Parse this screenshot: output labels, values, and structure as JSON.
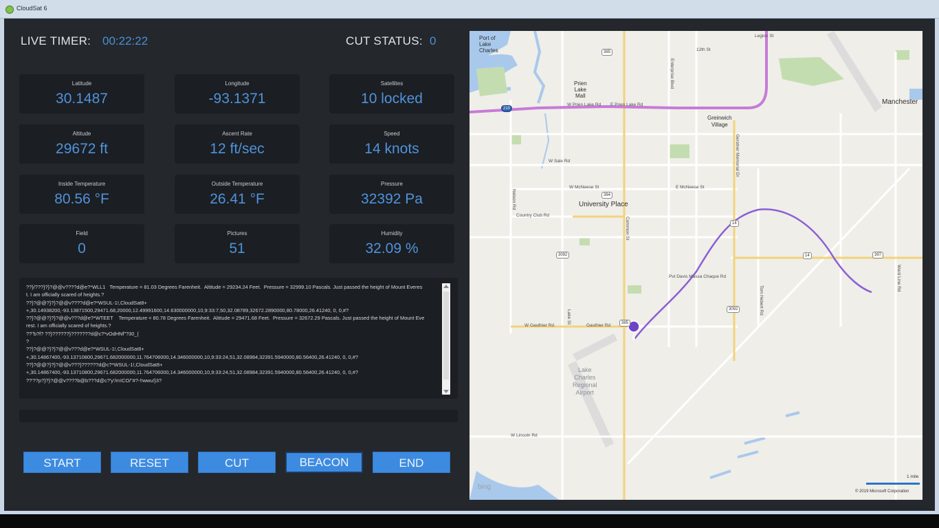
{
  "window": {
    "title": "CloudSat 6"
  },
  "header": {
    "timer_label": "LIVE TIMER:",
    "timer_value": "00:22:22",
    "cut_label": "CUT STATUS:",
    "cut_value": "0"
  },
  "tiles": [
    {
      "label": "Latitude",
      "value": "30.1487"
    },
    {
      "label": "Longitude",
      "value": "-93.1371"
    },
    {
      "label": "Satellites",
      "value": "10 locked"
    },
    {
      "label": "Altitude",
      "value": "29672 ft"
    },
    {
      "label": "Ascent Rate",
      "value": "12 ft/sec"
    },
    {
      "label": "Speed",
      "value": "14 knots"
    },
    {
      "label": "Inside Temperature",
      "value": "80.56 °F"
    },
    {
      "label": "Outside Temperature",
      "value": "26.41 °F"
    },
    {
      "label": "Pressure",
      "value": "32392 Pa"
    },
    {
      "label": "Field",
      "value": "0"
    },
    {
      "label": "Pictures",
      "value": "51"
    },
    {
      "label": "Humidity",
      "value": "32.09 %"
    }
  ],
  "console": {
    "text": "??}/???}?}?@@v????d@e?*WLL1   Temperature = 81.03 Degrees Farenheit.  Altitude = 29234.24 Feet.  Pressure = 32999.10 Pascals. Just passed the height of Mount Everest. I am officially scared of heights.?\n??}?@@?}?}?@@v????d@e?*WSUL-1!,CloudSat8+\n+,30.14938200,-93.13871500,29471.68,20000,12.49991600,14.630000000,10,9:33:7,50,32.08789,32672.2890000,80.78000,26.41240, 0, 0,#?\n??}?@@?}?}?@@v???d@e?*WTEET    Temperature = 80.78 Degrees Farenheit.  Altitude = 29471.68 Feet.  Pressure = 32672.29 Pascals. Just passed the height of Mount Everest. I am officially scared of heights.?\n??\"b?f? ??}??????}???????d@c?*vOdHNf\"?30_(\n?\n??}?@@?}?}?@@v???d@e?*WSUL-1!,CloudSat8+\n+,30.14867400,-93.13710800,29671.682000000,11.764706000,14.346000000,10,9:33:24,51,32.08984,32391.5940000,80.56400,26.41240, 0, 0,#?\n??}?@@?}?}?@@v???}??????d@c?*WSUL-1!,CloudSat8+\n+,30.14867400,-93.13710800,29671.682000000,11.764706000,14.346000000,10,9:33:24,51,32.08984,32391.5940000,80.56400,26.41240, 0, 0,#?\n??'??p?}?}?@@v????b@b???d@c?'y'/rn!CO/\"#?-!!wwu!}3?"
  },
  "buttons": {
    "start": "START",
    "reset": "RESET",
    "cut": "CUT",
    "beacon": "BEACON",
    "end": "END"
  },
  "map": {
    "labels": {
      "port": "Port of\nLake\nCharles",
      "prien": "Prien\nLake\nMall",
      "greinwich": "Greinwich\nVillage",
      "university": "University Place",
      "manchester": "Manchester",
      "airport": "Lake\nCharles\nRegional\nAirport",
      "w_prien": "W Prien Lake Rd",
      "e_prien": "E Prien Lake Rd",
      "w_sale": "W Sale Rd",
      "w_mcneese": "W McNeese St",
      "e_mcneese": "E McNeese St",
      "country_club": "Country Club Rd",
      "gauthier": "W Gauthier Rd",
      "gauthier2": "Gauthier Rd",
      "w_lincoln": "W Lincoln Rd",
      "gerstner": "Gerstner Memorial Dr",
      "nelson": "Nelson Rd",
      "common": "Common St",
      "ward_line": "Ward Line Rd",
      "s12th": "12th St",
      "legion": "Legion St",
      "ihop": "Pvt Davis Massa Chaque Rd",
      "tom_hebert": "Tom Hebert Rd",
      "enterprise": "Enterprise Blvd",
      "lake_st": "Lake St",
      "bing": "bing",
      "scale": "1 mile",
      "copyright": "© 2019 Microsoft Corporation"
    },
    "shields": [
      "385",
      "210",
      "384",
      "3092",
      "14",
      "14",
      "397",
      "3092",
      "385"
    ]
  },
  "colors": {
    "accent": "#3d8be0",
    "value_text": "#4f93dc",
    "panel": "#1b1e22",
    "background": "#24272c",
    "route": "#8b5fd6"
  }
}
